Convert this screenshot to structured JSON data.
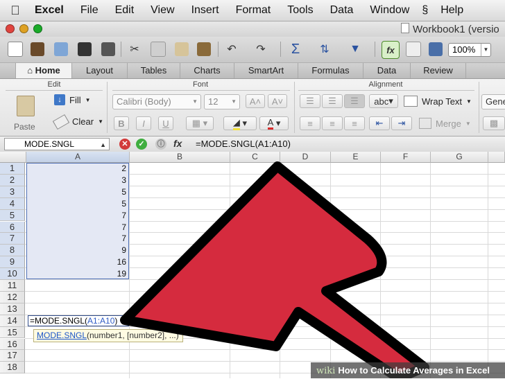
{
  "menubar": {
    "app": "Excel",
    "items": [
      "File",
      "Edit",
      "View",
      "Insert",
      "Format",
      "Tools",
      "Data",
      "Window",
      "Help"
    ]
  },
  "window": {
    "title": "Workbook1 (versio"
  },
  "toolbar": {
    "zoom": "100%"
  },
  "ribbon": {
    "tabs": [
      "Home",
      "Layout",
      "Tables",
      "Charts",
      "SmartArt",
      "Formulas",
      "Data",
      "Review"
    ],
    "groups": {
      "edit": "Edit",
      "font": "Font",
      "alignment": "Alignment"
    },
    "edit": {
      "paste": "Paste",
      "fill": "Fill",
      "clear": "Clear"
    },
    "font": {
      "name": "Calibri (Body)",
      "size": "12"
    },
    "alignment": {
      "wrap_text": "Wrap Text",
      "merge": "Merge",
      "abc": "abc"
    },
    "number": {
      "format": "Gene"
    }
  },
  "formula_bar": {
    "name_box": "MODE.SNGL",
    "fx": "fx",
    "formula": "=MODE.SNGL(A1:A10)"
  },
  "grid": {
    "columns": [
      "A",
      "B",
      "C",
      "D",
      "E",
      "F",
      "G"
    ],
    "rows": [
      "1",
      "2",
      "3",
      "4",
      "5",
      "6",
      "7",
      "8",
      "9",
      "10",
      "11",
      "12",
      "13",
      "14",
      "15",
      "16",
      "17",
      "18"
    ],
    "col_a_values": [
      "2",
      "3",
      "5",
      "5",
      "7",
      "7",
      "7",
      "9",
      "16",
      "19"
    ],
    "edit_cell": {
      "prefix": "=MODE.SNGL(",
      "ref": "A1:A10",
      "suffix": ")"
    },
    "tooltip": {
      "fn": "MODE.SNGL",
      "args": "(number1, [number2], ...)"
    }
  },
  "watermark": {
    "brand": "wiki",
    "text": "How to Calculate Averages in Excel"
  },
  "colors": {
    "arrow": "#d52b3e",
    "selection": "#e4e8f4",
    "selection_border": "#4d6fb6"
  }
}
